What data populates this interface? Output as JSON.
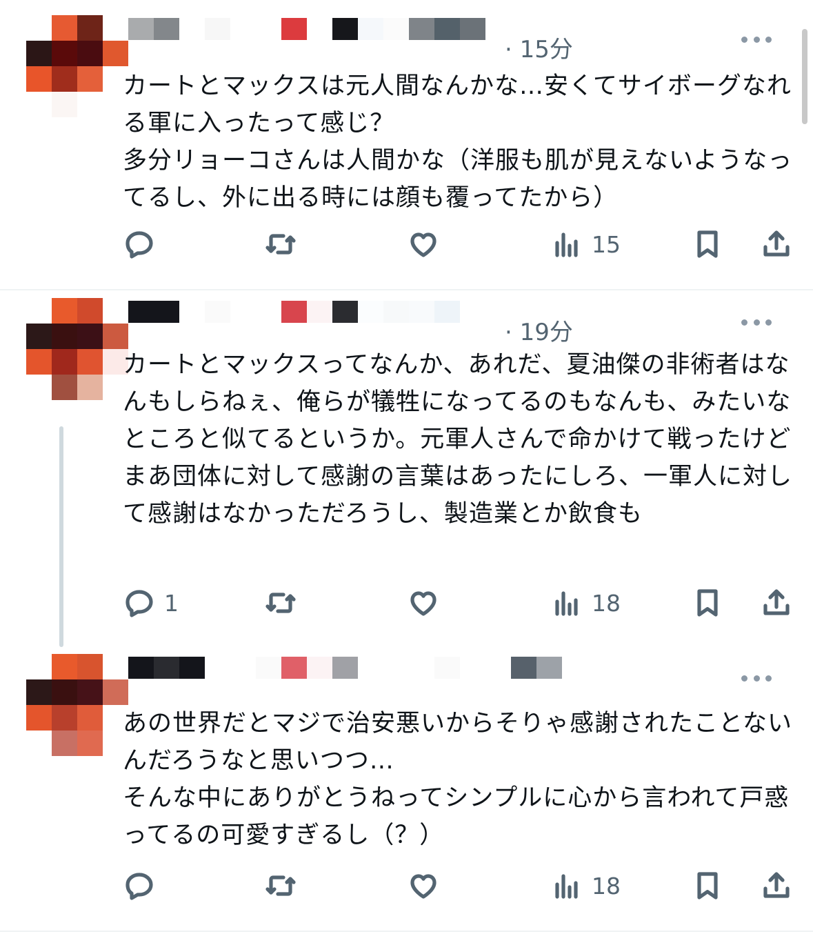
{
  "tweets": [
    {
      "time": "· 15分",
      "text": "カートとマックスは元人間なんかな…安くてサイボーグなれる軍に入ったって感じ？\n多分リョーコさんは人間かな（洋服も肌が見えないようなってるし、外に出る時には顔も覆ってたから）",
      "reply_count": "",
      "views": "15"
    },
    {
      "time": "· 19分",
      "text": "カートとマックスってなんか、あれだ、夏油傑の非術者はなんもしらねぇ、俺らが犠牲になってるのもなんも、みたいなところと似てるというか。元軍人さんで命かけて戦ったけどまあ団体に対して感謝の言葉はあったにしろ、一軍人に対して感謝はなかっただろうし、製造業とか飲食も",
      "reply_count": "1",
      "views": "18"
    },
    {
      "time": "",
      "text": "あの世界だとマジで治安悪いからそりゃ感謝されたことないんだろうなと思いつつ…\nそんな中にありがとうねってシンプルに心から言われて戸惑ってるの可愛すぎるし（？）",
      "reply_count": "",
      "views": "18"
    }
  ],
  "icons": [
    "reply-icon",
    "retweet-icon",
    "like-icon",
    "views-icon",
    "bookmark-icon",
    "share-icon",
    "more-icon"
  ],
  "colors": {
    "text": "#0f1419",
    "secondary": "#536471",
    "divider": "#eff3f4",
    "thread_line": "#cfd9de"
  }
}
